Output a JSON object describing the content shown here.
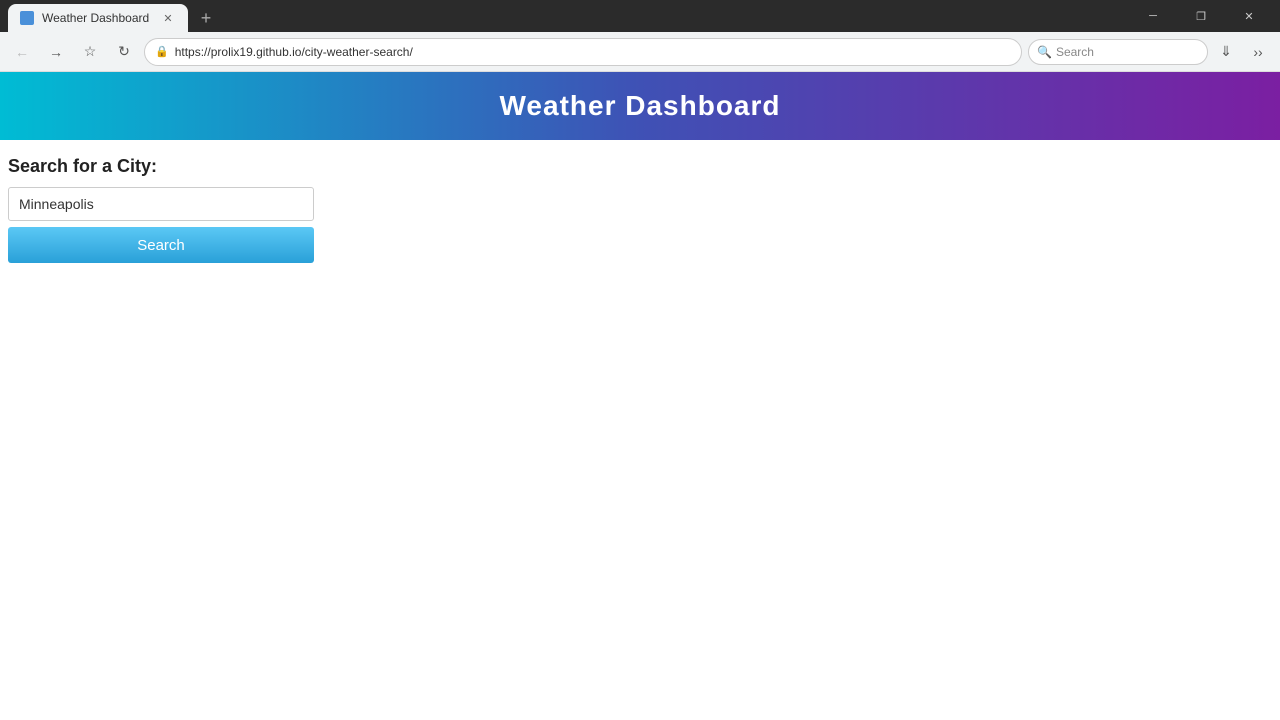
{
  "browser": {
    "tab": {
      "title": "Weather Dashboard",
      "favicon_color": "#4a90d9"
    },
    "address": "https://prolix19.github.io/city-weather-search/",
    "search_placeholder": "Search"
  },
  "nav": {
    "back_label": "‹",
    "forward_label": "›",
    "bookmark_label": "☆",
    "reload_label": "↻",
    "lock_label": "🔒"
  },
  "window_controls": {
    "minimize": "─",
    "restore": "❐",
    "close": "✕"
  },
  "app": {
    "header": {
      "title": "Weather Dashboard"
    },
    "search_section": {
      "label": "Search for a City:",
      "input_value": "Minneapolis",
      "input_placeholder": "Minneapolis",
      "button_label": "Search"
    }
  }
}
